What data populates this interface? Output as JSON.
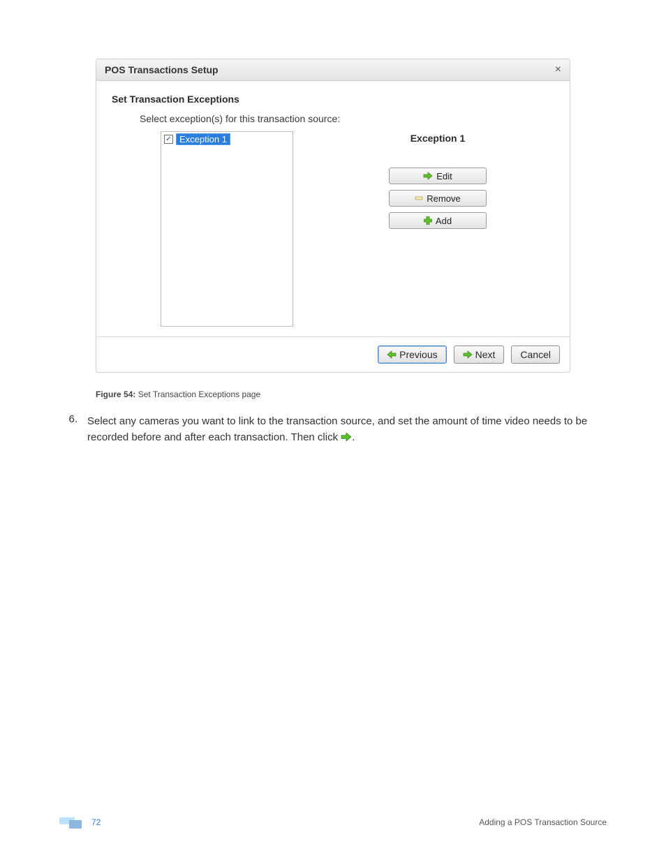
{
  "dialog": {
    "title": "POS Transactions Setup",
    "section_heading": "Set Transaction Exceptions",
    "instruction": "Select exception(s) for this transaction source:",
    "list": {
      "items": [
        {
          "label": "Exception 1",
          "checked": true,
          "selected": true
        }
      ]
    },
    "selected_name": "Exception 1",
    "buttons": {
      "edit": "Edit",
      "remove": "Remove",
      "add": "Add"
    },
    "footer": {
      "previous": "Previous",
      "next": "Next",
      "cancel": "Cancel"
    }
  },
  "caption": {
    "label": "Figure 54:",
    "text": "Set Transaction Exceptions page"
  },
  "step": {
    "number": "6.",
    "text_a": "Select any cameras you want to link to the transaction source, and set the amount of time video needs to be recorded before and after each transaction. Then click ",
    "text_b": "."
  },
  "footer": {
    "page": "72",
    "section": "Adding a POS Transaction Source"
  }
}
